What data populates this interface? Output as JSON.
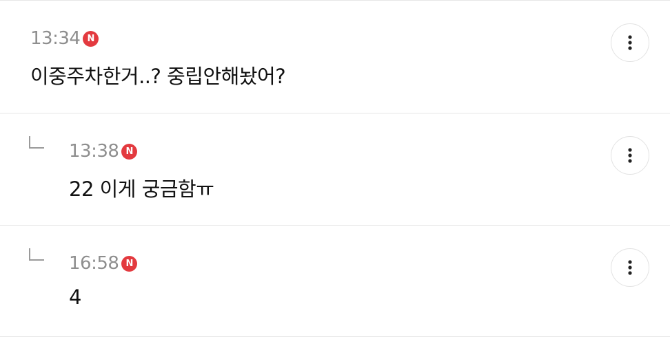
{
  "comments": [
    {
      "time": "13:34",
      "badge": "N",
      "text": "이중주차한거..? 중립안해놨어?",
      "is_reply": false
    },
    {
      "time": "13:38",
      "badge": "N",
      "text": "22 이게 궁금함ㅠ",
      "is_reply": true
    },
    {
      "time": "16:58",
      "badge": "N",
      "text": "4",
      "is_reply": true
    }
  ],
  "colors": {
    "badge": "#e33a3f",
    "time": "#8e8e8e",
    "divider": "#e6e6e6",
    "text": "#111111"
  },
  "icons": {
    "more": "more-vertical-icon",
    "reply": "reply-arrow-icon",
    "new": "new-badge-icon"
  }
}
